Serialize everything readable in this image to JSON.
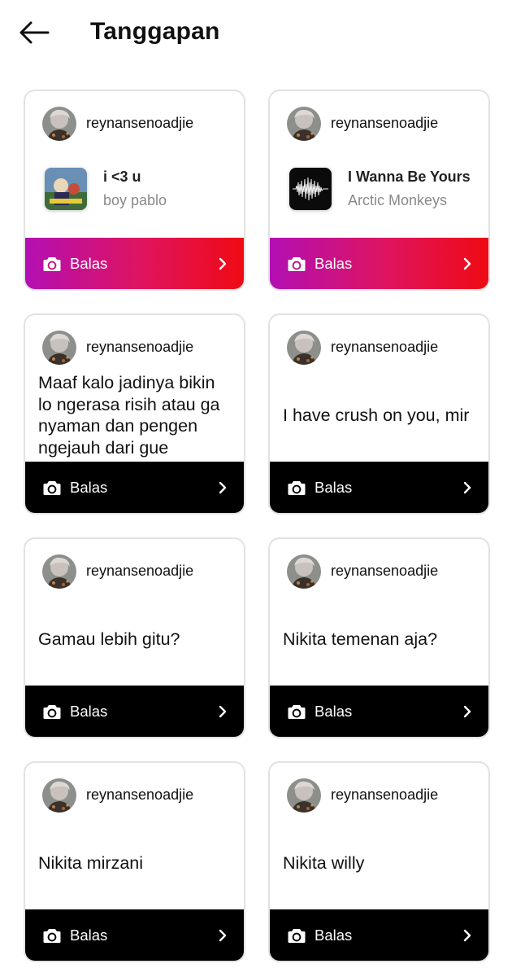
{
  "header": {
    "title": "Tanggapan",
    "back_icon": "arrow-left-icon"
  },
  "colors": {
    "reply_black": "#000000",
    "reply_gradient_start": "#b30fb4",
    "reply_gradient_end": "#ef0a14",
    "card_border": "#e2e2e2",
    "artist_gray": "#8a8a8a"
  },
  "cards": [
    {
      "username": "reynansenoadjie",
      "type": "music",
      "song_title": "i <3 u",
      "artist": "boy pablo",
      "reply_label": "Balas",
      "reply_style": "gradient"
    },
    {
      "username": "reynansenoadjie",
      "type": "music",
      "song_title": "I Wanna Be Yours",
      "artist": "Arctic Monkeys",
      "reply_label": "Balas",
      "reply_style": "gradient"
    },
    {
      "username": "reynansenoadjie",
      "type": "text",
      "message": "Maaf kalo jadinya bikin lo ngerasa risih atau ga nyaman dan pengen ngejauh dari gue",
      "reply_label": "Balas",
      "reply_style": "black"
    },
    {
      "username": "reynansenoadjie",
      "type": "text",
      "message": "I have crush on you, mir",
      "reply_label": "Balas",
      "reply_style": "black"
    },
    {
      "username": "reynansenoadjie",
      "type": "text",
      "message": "Gamau lebih gitu?",
      "reply_label": "Balas",
      "reply_style": "black"
    },
    {
      "username": "reynansenoadjie",
      "type": "text",
      "message": "Nikita temenan aja?",
      "reply_label": "Balas",
      "reply_style": "black"
    },
    {
      "username": "reynansenoadjie",
      "type": "text",
      "message": "Nikita mirzani",
      "reply_label": "Balas",
      "reply_style": "black"
    },
    {
      "username": "reynansenoadjie",
      "type": "text",
      "message": "Nikita willy",
      "reply_label": "Balas",
      "reply_style": "black"
    }
  ]
}
